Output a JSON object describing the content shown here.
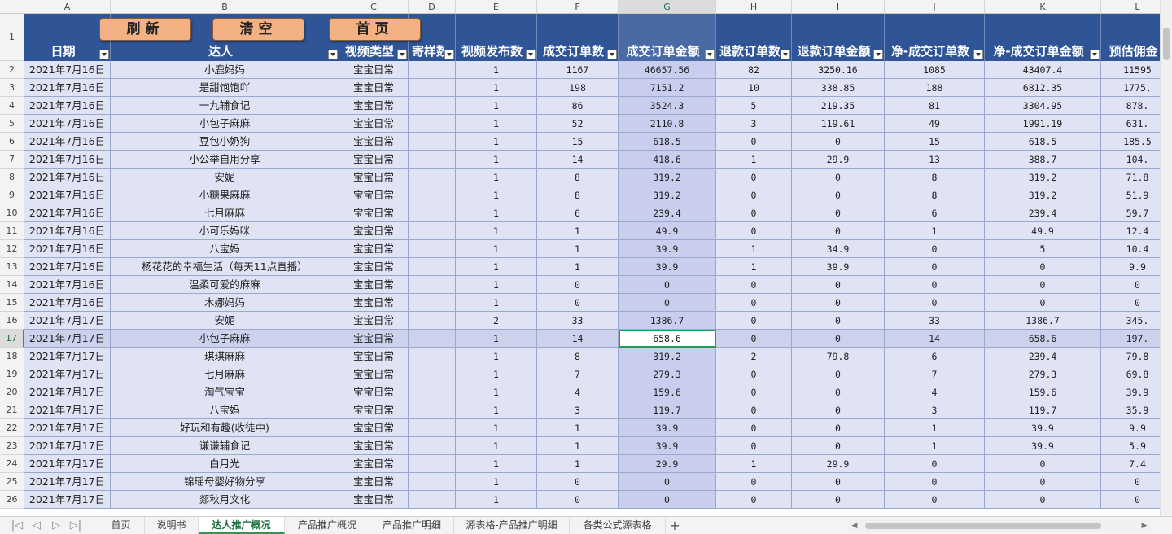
{
  "columns": [
    {
      "letter": "A",
      "header": "日期"
    },
    {
      "letter": "B",
      "header": "达人"
    },
    {
      "letter": "C",
      "header": "视频类型"
    },
    {
      "letter": "D",
      "header": "寄样数"
    },
    {
      "letter": "E",
      "header": "视频发布数"
    },
    {
      "letter": "F",
      "header": "成交订单数"
    },
    {
      "letter": "G",
      "header": "成交订单金额"
    },
    {
      "letter": "H",
      "header": "退款订单数"
    },
    {
      "letter": "I",
      "header": "退款订单金额"
    },
    {
      "letter": "J",
      "header": "净-成交订单数"
    },
    {
      "letter": "K",
      "header": "净-成交订单金额"
    },
    {
      "letter": "L",
      "header": "预估佣金"
    }
  ],
  "buttons": {
    "refresh": "刷新",
    "clear": "清空",
    "home": "首页"
  },
  "header_row_number": "1",
  "selected": {
    "column": "G",
    "row": "17"
  },
  "rows": [
    {
      "n": "2",
      "cells": [
        "2021年7月16日",
        "小鹿妈妈",
        "宝宝日常",
        "",
        "1",
        "1167",
        "46657.56",
        "82",
        "3250.16",
        "1085",
        "43407.4",
        "11595"
      ]
    },
    {
      "n": "3",
      "cells": [
        "2021年7月16日",
        "是甜饱饱吖",
        "宝宝日常",
        "",
        "1",
        "198",
        "7151.2",
        "10",
        "338.85",
        "188",
        "6812.35",
        "1775."
      ]
    },
    {
      "n": "4",
      "cells": [
        "2021年7月16日",
        "一九辅食记",
        "宝宝日常",
        "",
        "1",
        "86",
        "3524.3",
        "5",
        "219.35",
        "81",
        "3304.95",
        "878."
      ]
    },
    {
      "n": "5",
      "cells": [
        "2021年7月16日",
        "小包子麻麻",
        "宝宝日常",
        "",
        "1",
        "52",
        "2110.8",
        "3",
        "119.61",
        "49",
        "1991.19",
        "631."
      ]
    },
    {
      "n": "6",
      "cells": [
        "2021年7月16日",
        "豆包小奶狗",
        "宝宝日常",
        "",
        "1",
        "15",
        "618.5",
        "0",
        "0",
        "15",
        "618.5",
        "185.5"
      ]
    },
    {
      "n": "7",
      "cells": [
        "2021年7月16日",
        "小公举自用分享",
        "宝宝日常",
        "",
        "1",
        "14",
        "418.6",
        "1",
        "29.9",
        "13",
        "388.7",
        "104."
      ]
    },
    {
      "n": "8",
      "cells": [
        "2021年7月16日",
        "安妮",
        "宝宝日常",
        "",
        "1",
        "8",
        "319.2",
        "0",
        "0",
        "8",
        "319.2",
        "71.8"
      ]
    },
    {
      "n": "9",
      "cells": [
        "2021年7月16日",
        "小糖果麻麻",
        "宝宝日常",
        "",
        "1",
        "8",
        "319.2",
        "0",
        "0",
        "8",
        "319.2",
        "51.9"
      ]
    },
    {
      "n": "10",
      "cells": [
        "2021年7月16日",
        "七月麻麻",
        "宝宝日常",
        "",
        "1",
        "6",
        "239.4",
        "0",
        "0",
        "6",
        "239.4",
        "59.7"
      ]
    },
    {
      "n": "11",
      "cells": [
        "2021年7月16日",
        "小可乐妈咪",
        "宝宝日常",
        "",
        "1",
        "1",
        "49.9",
        "0",
        "0",
        "1",
        "49.9",
        "12.4"
      ]
    },
    {
      "n": "12",
      "cells": [
        "2021年7月16日",
        "八宝妈",
        "宝宝日常",
        "",
        "1",
        "1",
        "39.9",
        "1",
        "34.9",
        "0",
        "5",
        "10.4"
      ]
    },
    {
      "n": "13",
      "cells": [
        "2021年7月16日",
        "杨花花的幸福生活（每天11点直播）",
        "宝宝日常",
        "",
        "1",
        "1",
        "39.9",
        "1",
        "39.9",
        "0",
        "0",
        "9.9"
      ]
    },
    {
      "n": "14",
      "cells": [
        "2021年7月16日",
        "温柔可爱的麻麻",
        "宝宝日常",
        "",
        "1",
        "0",
        "0",
        "0",
        "0",
        "0",
        "0",
        "0"
      ]
    },
    {
      "n": "15",
      "cells": [
        "2021年7月16日",
        "木娜妈妈",
        "宝宝日常",
        "",
        "1",
        "0",
        "0",
        "0",
        "0",
        "0",
        "0",
        "0"
      ]
    },
    {
      "n": "16",
      "cells": [
        "2021年7月17日",
        "安妮",
        "宝宝日常",
        "",
        "2",
        "33",
        "1386.7",
        "0",
        "0",
        "33",
        "1386.7",
        "345."
      ]
    },
    {
      "n": "17",
      "cells": [
        "2021年7月17日",
        "小包子麻麻",
        "宝宝日常",
        "",
        "1",
        "14",
        "658.6",
        "0",
        "0",
        "14",
        "658.6",
        "197."
      ]
    },
    {
      "n": "18",
      "cells": [
        "2021年7月17日",
        "琪琪麻麻",
        "宝宝日常",
        "",
        "1",
        "8",
        "319.2",
        "2",
        "79.8",
        "6",
        "239.4",
        "79.8"
      ]
    },
    {
      "n": "19",
      "cells": [
        "2021年7月17日",
        "七月麻麻",
        "宝宝日常",
        "",
        "1",
        "7",
        "279.3",
        "0",
        "0",
        "7",
        "279.3",
        "69.8"
      ]
    },
    {
      "n": "20",
      "cells": [
        "2021年7月17日",
        "淘气宝宝",
        "宝宝日常",
        "",
        "1",
        "4",
        "159.6",
        "0",
        "0",
        "4",
        "159.6",
        "39.9"
      ]
    },
    {
      "n": "21",
      "cells": [
        "2021年7月17日",
        "八宝妈",
        "宝宝日常",
        "",
        "1",
        "3",
        "119.7",
        "0",
        "0",
        "3",
        "119.7",
        "35.9"
      ]
    },
    {
      "n": "22",
      "cells": [
        "2021年7月17日",
        "好玩和有趣(收徒中)",
        "宝宝日常",
        "",
        "1",
        "1",
        "39.9",
        "0",
        "0",
        "1",
        "39.9",
        "9.9"
      ]
    },
    {
      "n": "23",
      "cells": [
        "2021年7月17日",
        "谦谦辅食记",
        "宝宝日常",
        "",
        "1",
        "1",
        "39.9",
        "0",
        "0",
        "1",
        "39.9",
        "5.9"
      ]
    },
    {
      "n": "24",
      "cells": [
        "2021年7月17日",
        "白月光",
        "宝宝日常",
        "",
        "1",
        "1",
        "29.9",
        "1",
        "29.9",
        "0",
        "0",
        "7.4"
      ]
    },
    {
      "n": "25",
      "cells": [
        "2021年7月17日",
        "锦瑶母婴好物分享",
        "宝宝日常",
        "",
        "1",
        "0",
        "0",
        "0",
        "0",
        "0",
        "0",
        "0"
      ]
    },
    {
      "n": "26",
      "cells": [
        "2021年7月17日",
        "郯秋月文化",
        "宝宝日常",
        "",
        "1",
        "0",
        "0",
        "0",
        "0",
        "0",
        "0",
        "0"
      ]
    }
  ],
  "sheet_tabs": [
    {
      "label": "首页",
      "active": false
    },
    {
      "label": "说明书",
      "active": false
    },
    {
      "label": "达人推广概况",
      "active": true
    },
    {
      "label": "产品推广概况",
      "active": false
    },
    {
      "label": "产品推广明细",
      "active": false
    },
    {
      "label": "源表格-产品推广明细",
      "active": false
    },
    {
      "label": "各类公式源表格",
      "active": false
    }
  ],
  "nav_icons": [
    "first-sheet-icon",
    "prev-sheet-icon",
    "next-sheet-icon",
    "last-sheet-icon"
  ],
  "colors": {
    "header_bg": "#2f5597",
    "row_bg": "#dfe3f3",
    "selected_col_bg": "#c9cdee",
    "button_bg": "#f4b183",
    "active_tab": "#1f9d55"
  }
}
